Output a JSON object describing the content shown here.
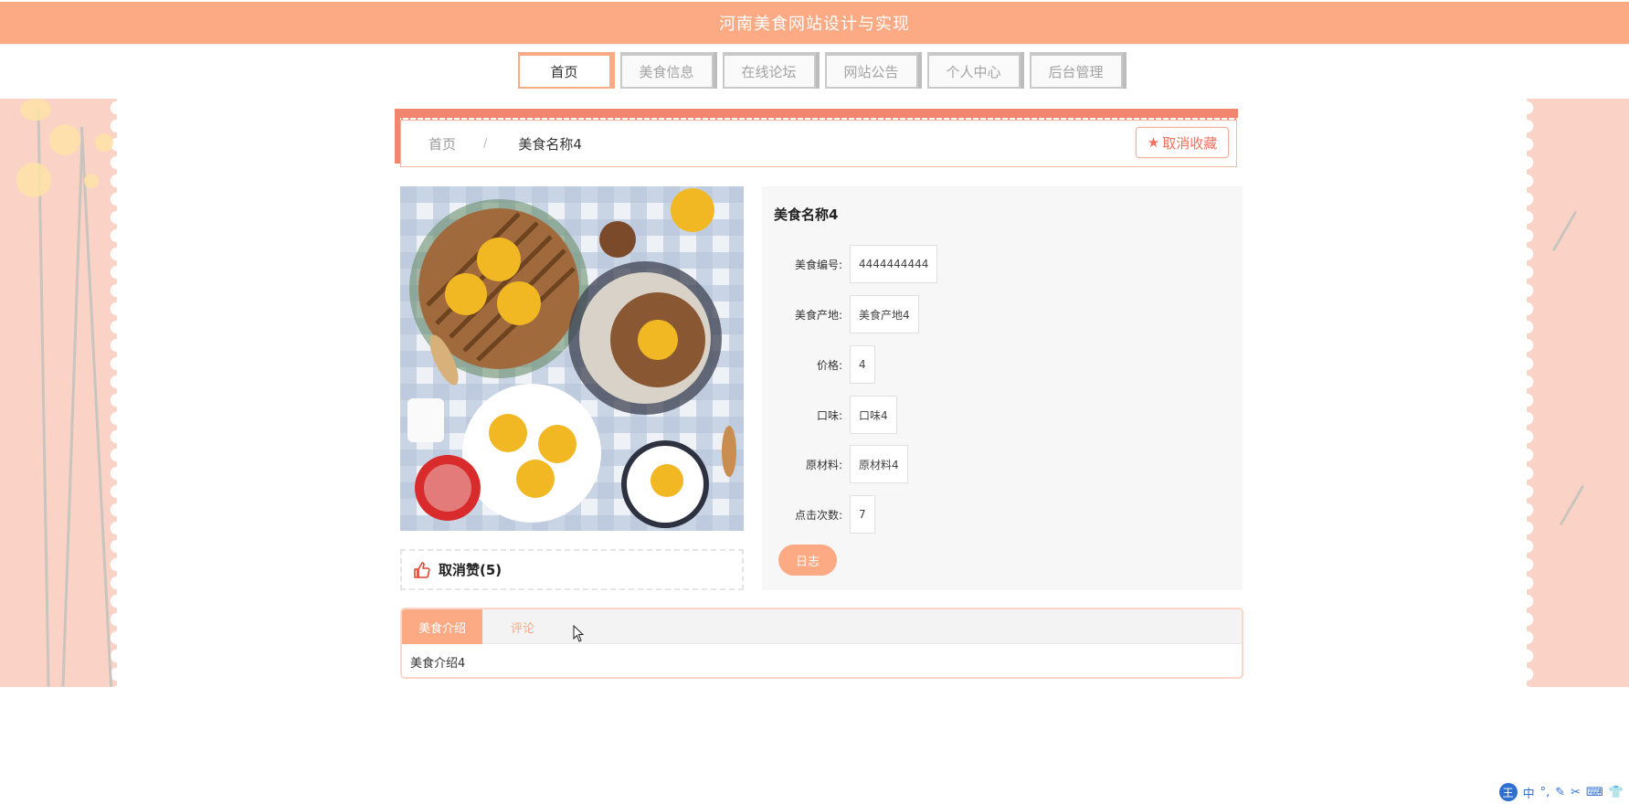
{
  "header": {
    "title": "河南美食网站设计与实现"
  },
  "nav": {
    "items": [
      {
        "label": "首页",
        "active": true
      },
      {
        "label": "美食信息",
        "active": false
      },
      {
        "label": "在线论坛",
        "active": false
      },
      {
        "label": "网站公告",
        "active": false
      },
      {
        "label": "个人中心",
        "active": false
      },
      {
        "label": "后台管理",
        "active": false
      }
    ]
  },
  "breadcrumb": {
    "home": "首页",
    "separator": "/",
    "current": "美食名称4"
  },
  "favorite": {
    "label": "取消收藏",
    "icon": "star-icon"
  },
  "like": {
    "label": "取消赞(5)",
    "icon": "thumbs-up-icon"
  },
  "detail": {
    "title": "美食名称4",
    "fields": [
      {
        "label": "美食编号:",
        "value": "4444444444"
      },
      {
        "label": "美食产地:",
        "value": "美食产地4"
      },
      {
        "label": "价格:",
        "value": "4"
      },
      {
        "label": "口味:",
        "value": "口味4"
      },
      {
        "label": "原材料:",
        "value": "原材料4"
      },
      {
        "label": "点击次数:",
        "value": "7"
      }
    ],
    "log_button": "日志"
  },
  "tabs": {
    "items": [
      {
        "label": "美食介绍",
        "active": true
      },
      {
        "label": "评论",
        "active": false
      }
    ],
    "content": "美食介绍4"
  },
  "ime": {
    "logo": "王",
    "items": [
      "中",
      "°,",
      "✎",
      "✂",
      "⌨",
      "👕"
    ]
  },
  "colors": {
    "primary": "#fbaa84",
    "accent": "#f2856d",
    "side": "#fbd2c6",
    "favorite_text": "#f0705c"
  }
}
